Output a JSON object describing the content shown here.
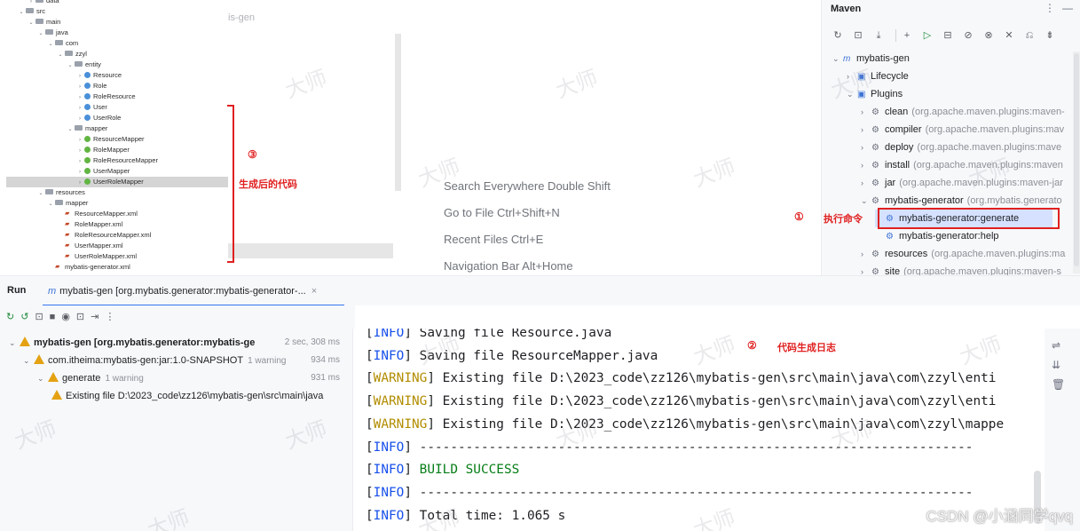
{
  "project_tree": {
    "items": [
      {
        "label": "data",
        "kind": "folder",
        "indent": 3,
        "chev": "›"
      },
      {
        "label": "src",
        "kind": "folder",
        "indent": 2,
        "chev": "⌄"
      },
      {
        "label": "main",
        "kind": "folder",
        "indent": 3,
        "chev": "⌄"
      },
      {
        "label": "java",
        "kind": "folder",
        "indent": 4,
        "chev": "⌄"
      },
      {
        "label": "com",
        "kind": "folder",
        "indent": 5,
        "chev": "⌄"
      },
      {
        "label": "zzyl",
        "kind": "folder",
        "indent": 6,
        "chev": "⌄"
      },
      {
        "label": "entity",
        "kind": "folder",
        "indent": 7,
        "chev": "⌄"
      },
      {
        "label": "Resource",
        "kind": "class",
        "indent": 8,
        "chev": "›"
      },
      {
        "label": "Role",
        "kind": "class",
        "indent": 8,
        "chev": "›"
      },
      {
        "label": "RoleResource",
        "kind": "class",
        "indent": 8,
        "chev": "›"
      },
      {
        "label": "User",
        "kind": "class",
        "indent": 8,
        "chev": "›"
      },
      {
        "label": "UserRole",
        "kind": "class",
        "indent": 8,
        "chev": "›"
      },
      {
        "label": "mapper",
        "kind": "folder",
        "indent": 7,
        "chev": "⌄"
      },
      {
        "label": "ResourceMapper",
        "kind": "interface",
        "indent": 8,
        "chev": "›"
      },
      {
        "label": "RoleMapper",
        "kind": "interface",
        "indent": 8,
        "chev": "›"
      },
      {
        "label": "RoleResourceMapper",
        "kind": "interface",
        "indent": 8,
        "chev": "›"
      },
      {
        "label": "UserMapper",
        "kind": "interface",
        "indent": 8,
        "chev": "›"
      },
      {
        "label": "UserRoleMapper",
        "kind": "interface",
        "indent": 8,
        "chev": "›",
        "selected": true
      },
      {
        "label": "resources",
        "kind": "folder",
        "indent": 4,
        "chev": "⌄"
      },
      {
        "label": "mapper",
        "kind": "folder",
        "indent": 5,
        "chev": "⌄"
      },
      {
        "label": "ResourceMapper.xml",
        "kind": "xml",
        "indent": 6,
        "chev": ""
      },
      {
        "label": "RoleMapper.xml",
        "kind": "xml",
        "indent": 6,
        "chev": ""
      },
      {
        "label": "RoleResourceMapper.xml",
        "kind": "xml",
        "indent": 6,
        "chev": ""
      },
      {
        "label": "UserMapper.xml",
        "kind": "xml",
        "indent": 6,
        "chev": ""
      },
      {
        "label": "UserRoleMapper.xml",
        "kind": "xml",
        "indent": 6,
        "chev": ""
      },
      {
        "label": "mybatis-generator.xml",
        "kind": "xml",
        "indent": 5,
        "chev": ""
      }
    ]
  },
  "editor": {
    "tab_fragment": "is-gen",
    "hints": [
      "Search Everywhere Double Shift",
      "Go to File Ctrl+Shift+N",
      "Recent Files Ctrl+E",
      "Navigation Bar Alt+Home"
    ]
  },
  "maven": {
    "title": "Maven",
    "menu_icon": "⋮",
    "minimize_icon": "—",
    "toolbar_icons": [
      "↻",
      "⊡",
      "⤓",
      "+",
      "▷",
      "⊟",
      "⊘",
      "⊗",
      "✕",
      "⎌",
      "⇟"
    ],
    "tree": [
      {
        "label": "mybatis-gen",
        "detail": "",
        "indent": 0,
        "chev": "⌄",
        "icon": "m"
      },
      {
        "label": "Lifecycle",
        "detail": "",
        "indent": 1,
        "chev": "›",
        "icon": "folder"
      },
      {
        "label": "Plugins",
        "detail": "",
        "indent": 1,
        "chev": "⌄",
        "icon": "folder"
      },
      {
        "label": "clean",
        "detail": "(org.apache.maven.plugins:maven-",
        "indent": 2,
        "chev": "›",
        "icon": "plugin"
      },
      {
        "label": "compiler",
        "detail": "(org.apache.maven.plugins:mav",
        "indent": 2,
        "chev": "›",
        "icon": "plugin"
      },
      {
        "label": "deploy",
        "detail": "(org.apache.maven.plugins:mave",
        "indent": 2,
        "chev": "›",
        "icon": "plugin"
      },
      {
        "label": "install",
        "detail": "(org.apache.maven.plugins:maven",
        "indent": 2,
        "chev": "›",
        "icon": "plugin"
      },
      {
        "label": "jar",
        "detail": "(org.apache.maven.plugins:maven-jar",
        "indent": 2,
        "chev": "›",
        "icon": "plugin"
      },
      {
        "label": "mybatis-generator",
        "detail": "(org.mybatis.generato",
        "indent": 2,
        "chev": "⌄",
        "icon": "plugin"
      },
      {
        "label": "mybatis-generator:generate",
        "detail": "",
        "indent": 3,
        "chev": "",
        "icon": "goal",
        "selected": true
      },
      {
        "label": "mybatis-generator:help",
        "detail": "",
        "indent": 3,
        "chev": "",
        "icon": "goal"
      },
      {
        "label": "resources",
        "detail": "(org.apache.maven.plugins:ma",
        "indent": 2,
        "chev": "›",
        "icon": "plugin"
      },
      {
        "label": "site",
        "detail": "(org.apache.maven.plugins:maven-s",
        "indent": 2,
        "chev": "›",
        "icon": "plugin"
      }
    ]
  },
  "run": {
    "label": "Run",
    "tab_icon": "m",
    "tab_label": "mybatis-gen [org.mybatis.generator:mybatis-generator-...",
    "tab_close": "×",
    "toolbar_icons": [
      "↻",
      "↺",
      "⊡",
      "■",
      "◉",
      "⊡",
      "⇥",
      "⋮"
    ],
    "tree": [
      {
        "label": "mybatis-gen [org.mybatis.generator:mybatis-ge",
        "sub": "",
        "time": "2 sec, 308 ms",
        "indent": 0,
        "chev": "⌄",
        "bold": true
      },
      {
        "label": "com.itheima:mybatis-gen:jar:1.0-SNAPSHOT",
        "sub": "1 warning",
        "time": "934 ms",
        "indent": 1,
        "chev": "⌄",
        "bold": false
      },
      {
        "label": "generate",
        "sub": "1 warning",
        "time": "931 ms",
        "indent": 2,
        "chev": "⌄",
        "bold": false
      },
      {
        "label": "Existing file D:\\2023_code\\zz126\\mybatis-gen\\src\\main\\java",
        "sub": "",
        "time": "",
        "indent": 3,
        "chev": "",
        "bold": false
      }
    ],
    "console": [
      {
        "tag": "INFO",
        "text": " Saving file Resource.java",
        "style": "info"
      },
      {
        "tag": "INFO",
        "text": " Saving file ResourceMapper.java",
        "style": "info"
      },
      {
        "tag": "WARNING",
        "text": " Existing file D:\\2023_code\\zz126\\mybatis-gen\\src\\main\\java\\com\\zzyl\\enti",
        "style": "warn"
      },
      {
        "tag": "WARNING",
        "text": " Existing file D:\\2023_code\\zz126\\mybatis-gen\\src\\main\\java\\com\\zzyl\\enti",
        "style": "warn"
      },
      {
        "tag": "WARNING",
        "text": " Existing file D:\\2023_code\\zz126\\mybatis-gen\\src\\main\\java\\com\\zzyl\\mappe",
        "style": "warn"
      },
      {
        "tag": "INFO",
        "text": " ------------------------------------------------------------------------",
        "style": "info"
      },
      {
        "tag": "INFO",
        "text": " BUILD SUCCESS",
        "style": "success"
      },
      {
        "tag": "INFO",
        "text": " ------------------------------------------------------------------------",
        "style": "info"
      },
      {
        "tag": "INFO",
        "text": " Total time:  1.065 s",
        "style": "info"
      }
    ],
    "side_icons": [
      "⇌",
      "⇊",
      "🗑"
    ]
  },
  "annotations": {
    "num1": "①",
    "num2": "②",
    "num3": "③",
    "cmd_label": "执行命令",
    "log_label": "代码生成日志",
    "code_label": "生成后的代码",
    "watermark": "大师",
    "csdn": "CSDN @小涵同学qvq",
    "color": "#e02020"
  }
}
